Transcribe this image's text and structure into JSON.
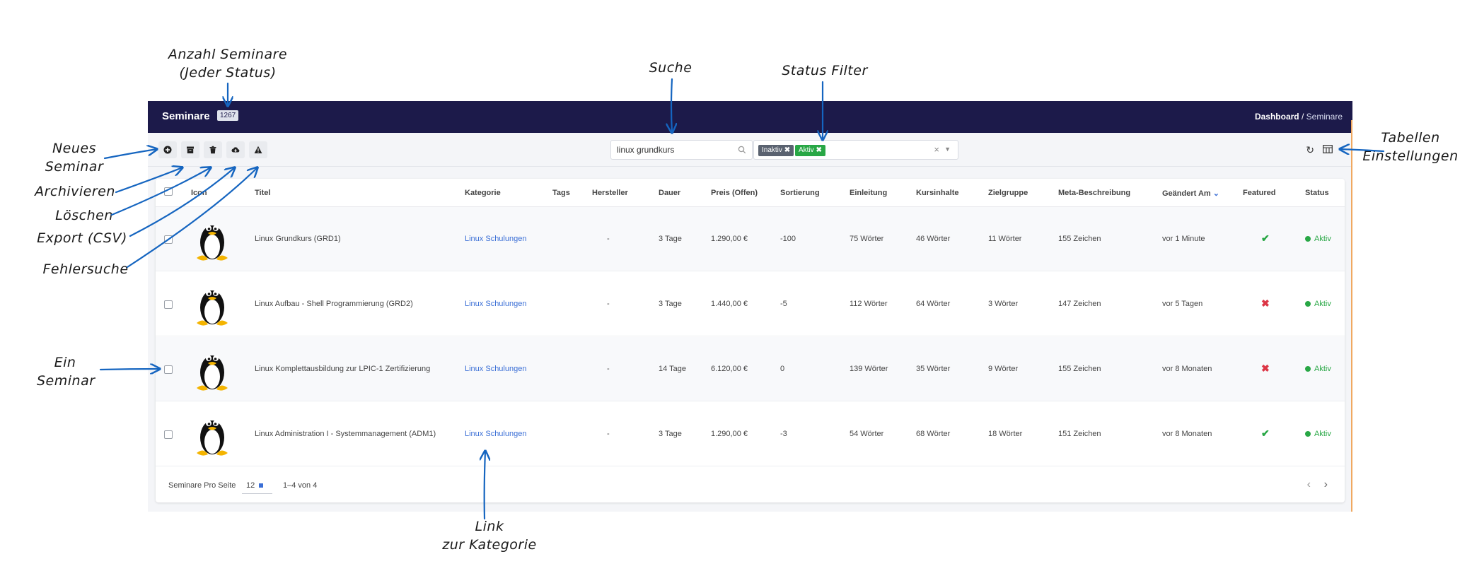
{
  "annotations": {
    "anzahl": [
      "Anzahl Seminare",
      "(Jeder Status)"
    ],
    "suche": "Suche",
    "status_filter": "Status Filter",
    "neues": [
      "Neues",
      "Seminar"
    ],
    "archivieren": "Archivieren",
    "loeschen": "Löschen",
    "export": "Export (CSV)",
    "fehlersuche": "Fehlersuche",
    "ein_seminar": [
      "Ein",
      "Seminar"
    ],
    "tabellen": [
      "Tabellen",
      "Einstellungen"
    ],
    "link": [
      "Link",
      "zur Kategorie"
    ]
  },
  "topbar": {
    "title": "Seminare",
    "count": "1267",
    "crumb_home": "Dashboard",
    "crumb_sep": " / ",
    "crumb_current": "Seminare"
  },
  "toolbar": {
    "new_icon": "plus-circle-icon",
    "archive_icon": "archive-icon",
    "delete_icon": "trash-icon",
    "export_icon": "cloud-download-icon",
    "debug_icon": "warning-icon",
    "search_value": "linux grundkurs",
    "filter_chips": [
      "Inaktiv",
      "Aktiv"
    ],
    "clear": "×",
    "refresh": "↻"
  },
  "table": {
    "headers": [
      "Icon",
      "Titel",
      "Kategorie",
      "Tags",
      "Hersteller",
      "Dauer",
      "Preis (Offen)",
      "Sortierung",
      "Einleitung",
      "Kursinhalte",
      "Zielgruppe",
      "Meta-Beschreibung",
      "Geändert Am",
      "Featured",
      "Status"
    ],
    "rows": [
      {
        "title": "Linux Grundkurs (GRD1)",
        "category": "Linux Schulungen",
        "tags": "",
        "vendor": "-",
        "duration": "3 Tage",
        "price": "1.290,00 €",
        "sort": "-100",
        "intro": "75 Wörter",
        "content": "46 Wörter",
        "audience": "11 Wörter",
        "meta": "155 Zeichen",
        "changed": "vor 1 Minute",
        "featured": "✔",
        "status": "Aktiv"
      },
      {
        "title": "Linux Aufbau - Shell Programmierung (GRD2)",
        "category": "Linux Schulungen",
        "tags": "",
        "vendor": "-",
        "duration": "3 Tage",
        "price": "1.440,00 €",
        "sort": "-5",
        "intro": "112 Wörter",
        "content": "64 Wörter",
        "audience": "3 Wörter",
        "meta": "147 Zeichen",
        "changed": "vor 5 Tagen",
        "featured": "✖",
        "status": "Aktiv"
      },
      {
        "title": "Linux Komplettausbildung zur LPIC-1 Zertifizierung",
        "category": "Linux Schulungen",
        "tags": "",
        "vendor": "-",
        "duration": "14 Tage",
        "price": "6.120,00 €",
        "sort": "0",
        "intro": "139 Wörter",
        "content": "35 Wörter",
        "audience": "9 Wörter",
        "meta": "155 Zeichen",
        "changed": "vor 8 Monaten",
        "featured": "✖",
        "status": "Aktiv"
      },
      {
        "title": "Linux Administration I - Systemmanagement (ADM1)",
        "category": "Linux Schulungen",
        "tags": "",
        "vendor": "-",
        "duration": "3 Tage",
        "price": "1.290,00 €",
        "sort": "-3",
        "intro": "54 Wörter",
        "content": "68 Wörter",
        "audience": "18 Wörter",
        "meta": "151 Zeichen",
        "changed": "vor 8 Monaten",
        "featured": "✔",
        "status": "Aktiv"
      }
    ]
  },
  "footer": {
    "per_page_label": "Seminare Pro Seite",
    "per_page_value": "12",
    "range": "1–4 von 4",
    "prev": "‹",
    "next": "›"
  },
  "colors": {
    "topbar": "#1c1a4a",
    "link": "#3b6fd6",
    "active": "#28a745",
    "danger": "#dc3545",
    "annotation_arrow": "#1565c0"
  }
}
